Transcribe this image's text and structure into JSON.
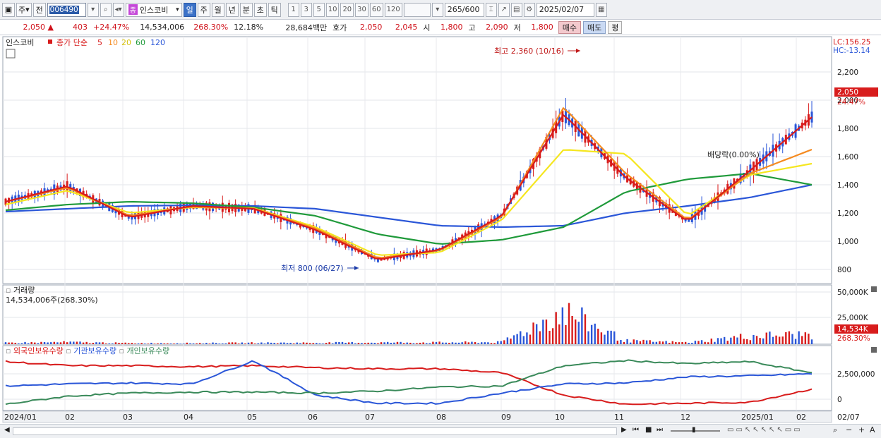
{
  "toolbar": {
    "type_label": "주",
    "prev_label": "전",
    "code": "006490",
    "badge": "종",
    "stock_name": "인스코비",
    "periods": [
      "일",
      "주",
      "월",
      "년",
      "분",
      "초",
      "틱"
    ],
    "selected_period": "일",
    "minutes": [
      "1",
      "3",
      "5",
      "10",
      "20",
      "30",
      "60",
      "120"
    ],
    "page_value": "265",
    "page_total": "/600",
    "date": "2025/02/07"
  },
  "quote": {
    "price": "2,050",
    "change": "403",
    "change_pct": "+24.47%",
    "volume": "14,534,006",
    "volume_ratio": "268.30%",
    "turnover": "12.18%",
    "amount": "28,684백만",
    "bid_label": "호가",
    "bid1": "2,050",
    "bid2": "2,045",
    "open_label": "시",
    "open": "1,800",
    "high_label": "고",
    "high": "2,090",
    "low_label": "저",
    "low": "1,800",
    "buy_label": "매수",
    "sell_label": "매도",
    "eval_label": "평"
  },
  "price_panel": {
    "title": "인스코비",
    "ma_title": "종가 단순",
    "ma_labels": [
      "5",
      "10",
      "20",
      "60",
      "120"
    ],
    "ma_colors": [
      "#d81c1c",
      "#f58a1f",
      "#f5e61f",
      "#1f9a3a",
      "#2a56d8"
    ],
    "lc_label": "LC:156.25",
    "hc_label": "HC:-13.14",
    "y_ticks": [
      "2,200",
      "2,000",
      "1,800",
      "1,600",
      "1,400",
      "1,200",
      "1,000",
      "800"
    ],
    "current_price_tag": "2,050",
    "current_pct_tag": "24.47%",
    "high_annotation": "최고 2,360 (10/16)",
    "low_annotation": "최저 800 (06/27)",
    "dividend_annotation": "배당락(0.00%)"
  },
  "volume_panel": {
    "title": "거래량",
    "value_label": "14,534,006주(268.30%)",
    "y_ticks": [
      "50,000K",
      "25,000K"
    ],
    "current_tag": "14,534K",
    "current_pct": "268.30%"
  },
  "holding_panel": {
    "legend": [
      "외국인보유수량",
      "기관보유수량",
      "개인보유수량"
    ],
    "colors": [
      "#d81c1c",
      "#2a56d8",
      "#3a8a5a"
    ],
    "y_ticks": [
      "2,500,000",
      "0"
    ]
  },
  "x_axis": {
    "labels": [
      "2024/01",
      "02",
      "03",
      "04",
      "05",
      "06",
      "07",
      "08",
      "09",
      "10",
      "11",
      "12",
      "2025/01",
      "02"
    ],
    "end_label": "02/07"
  },
  "chart_data": {
    "type": "line",
    "title": "",
    "x": [
      "2024/01",
      "02",
      "03",
      "04",
      "05",
      "06",
      "07",
      "08",
      "09",
      "10",
      "11",
      "12",
      "2025/01",
      "02"
    ],
    "ylim": [
      700,
      2400
    ],
    "series": [
      {
        "name": "5",
        "values": [
          1280,
          1390,
          1170,
          1250,
          1230,
          1080,
          870,
          940,
          1180,
          1900,
          1450,
          1140,
          1500,
          1880
        ]
      },
      {
        "name": "10",
        "values": [
          1280,
          1380,
          1180,
          1245,
          1232,
          1090,
          880,
          935,
          1170,
          1950,
          1480,
          1150,
          1480,
          1650
        ]
      },
      {
        "name": "20",
        "values": [
          1260,
          1360,
          1200,
          1240,
          1235,
          1100,
          900,
          920,
          1150,
          1650,
          1620,
          1180,
          1470,
          1550
        ]
      },
      {
        "name": "60",
        "values": [
          1220,
          1260,
          1280,
          1270,
          1240,
          1180,
          1050,
          980,
          1010,
          1100,
          1350,
          1440,
          1480,
          1400
        ]
      },
      {
        "name": "120",
        "values": [
          1210,
          1230,
          1250,
          1255,
          1250,
          1230,
          1170,
          1110,
          1100,
          1110,
          1200,
          1250,
          1310,
          1400
        ]
      }
    ],
    "volume_values": [
      2,
      3,
      1.5,
      1.5,
      2,
      2,
      2.5,
      2.5,
      3,
      48,
      5,
      2.5,
      12,
      14.5
    ],
    "holding_series": [
      {
        "name": "외국인보유수량",
        "values": [
          3.7,
          3.3,
          3.3,
          3.2,
          3.3,
          3.1,
          3.0,
          3.0,
          2.6,
          0.4,
          -0.5,
          -0.4,
          -0.3,
          1.0
        ]
      },
      {
        "name": "기관보유수량",
        "values": [
          1.3,
          1.5,
          1.6,
          1.5,
          3.8,
          0.4,
          -0.4,
          -0.4,
          0.6,
          1.5,
          1.6,
          2.2,
          2.3,
          2.5
        ]
      },
      {
        "name": "개인보유수량",
        "values": [
          -0.5,
          0.3,
          0.6,
          0.7,
          0.7,
          0.6,
          0.8,
          1.2,
          1.3,
          3.3,
          3.8,
          3.5,
          3.7,
          2.6
        ]
      }
    ]
  }
}
